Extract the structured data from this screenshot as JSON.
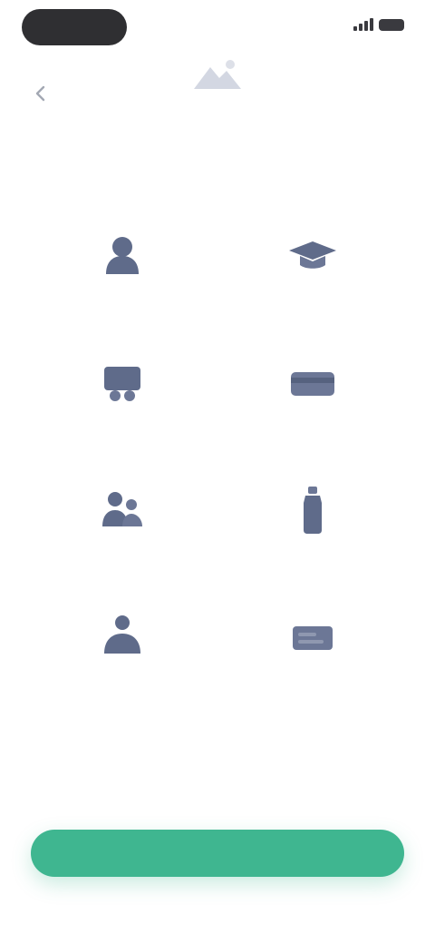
{
  "colors": {
    "accent": "#3fb690",
    "icon": "#5f6b8a",
    "muted_text": "#cfd2dc",
    "status_pill": "#2f2f32"
  },
  "status_bar": {
    "time": "",
    "icons": [
      "signal-icon",
      "battery-icon"
    ]
  },
  "nav": {
    "back_icon": "back-arrow-icon"
  },
  "header": {
    "icon": "mountain-icon",
    "title": "",
    "subtitle": ""
  },
  "options": [
    {
      "icon": "user-icon",
      "label": ""
    },
    {
      "icon": "cap-icon",
      "label": ""
    },
    {
      "icon": "group-icon",
      "label": ""
    },
    {
      "icon": "card-icon",
      "label": ""
    },
    {
      "icon": "family-icon",
      "label": ""
    },
    {
      "icon": "bottle-icon",
      "label": ""
    },
    {
      "icon": "couple-icon",
      "label": ""
    },
    {
      "icon": "document-icon",
      "label": ""
    }
  ],
  "footer": {
    "button_label": ""
  }
}
